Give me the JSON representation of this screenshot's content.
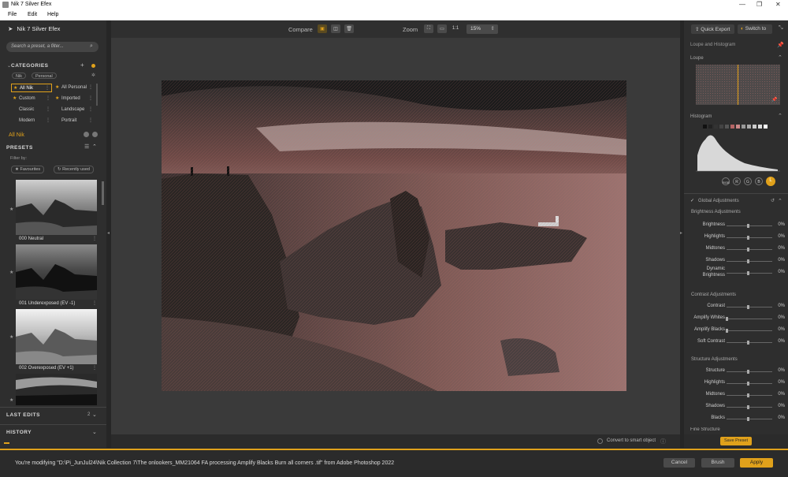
{
  "window": {
    "title": "Nik 7 Silver Efex"
  },
  "menu": {
    "file": "File",
    "edit": "Edit",
    "help": "Help"
  },
  "app": {
    "name": "Nik 7 Silver Efex"
  },
  "search": {
    "placeholder": "Search a preset, a filter..."
  },
  "categories": {
    "header": "CATEGORIES",
    "chips": [
      "Nik",
      "Personal"
    ],
    "items": [
      {
        "label": "All Nik",
        "starred": true,
        "selected": true
      },
      {
        "label": "All Personal",
        "starred": true,
        "selected": false
      },
      {
        "label": "Custom",
        "starred": true,
        "selected": false
      },
      {
        "label": "Imported",
        "starred": true,
        "selected": false
      },
      {
        "label": "Classic",
        "starred": false,
        "selected": false
      },
      {
        "label": "Landscape",
        "starred": false,
        "selected": false
      },
      {
        "label": "Modern",
        "starred": false,
        "selected": false
      },
      {
        "label": "Portrait",
        "starred": false,
        "selected": false
      }
    ]
  },
  "current_collection": "All Nik",
  "presets": {
    "header": "PRESETS",
    "filter_by": "Filter by:",
    "favourites": "Favourites",
    "recently_used": "Recently used",
    "items": [
      "000 Neutral",
      "001 Underexposed (EV -1)",
      "002 Overexposed (EV +1)"
    ]
  },
  "last_edits": {
    "label": "LAST EDITS",
    "count": "2"
  },
  "history": {
    "label": "HISTORY"
  },
  "toolbar": {
    "compare": "Compare",
    "zoom": "Zoom",
    "zoom_one": "1:1",
    "zoom_value": "15%"
  },
  "right": {
    "quick_export": "Quick Export",
    "switch_to": "Switch to",
    "loupe_histogram": "Loupe and Histogram",
    "loupe": "Loupe",
    "histogram": "Histogram",
    "channels": [
      "RGB",
      "R",
      "G",
      "B",
      "L"
    ],
    "global_adjustments": "Global Adjustments"
  },
  "brightness": {
    "title": "Brightness Adjustments",
    "rows": [
      {
        "label": "Brightness",
        "value": "0%"
      },
      {
        "label": "Highlights",
        "value": "0%"
      },
      {
        "label": "Midtones",
        "value": "0%"
      },
      {
        "label": "Shadows",
        "value": "0%"
      },
      {
        "label": "Dynamic Brightness",
        "value": "0%"
      }
    ]
  },
  "contrast": {
    "title": "Contrast Adjustments",
    "rows": [
      {
        "label": "Contrast",
        "value": "0%"
      },
      {
        "label": "Amplify Whites",
        "value": "0%"
      },
      {
        "label": "Amplify Blacks",
        "value": "0%"
      },
      {
        "label": "Soft Contrast",
        "value": "0%"
      }
    ]
  },
  "structure": {
    "title": "Structure Adjustments",
    "rows": [
      {
        "label": "Structure",
        "value": "0%"
      },
      {
        "label": "Highlights",
        "value": "0%"
      },
      {
        "label": "Midtones",
        "value": "0%"
      },
      {
        "label": "Shadows",
        "value": "0%"
      },
      {
        "label": "Blacks",
        "value": "0%"
      }
    ],
    "cut": "Fine Structure"
  },
  "convert_smart": "Convert to smart object",
  "save_preset": "Save Preset",
  "status": {
    "message": "You're modifying \"D:\\Pi_JunJul24\\Nik Collection 7\\The onlookers_MM21064 FA processing Amplify Blacks Burn all corners .tif\" from Adobe Photoshop 2022"
  },
  "buttons": {
    "cancel": "Cancel",
    "brush": "Brush",
    "apply": "Apply"
  },
  "colors": {
    "accent": "#e0a11b"
  }
}
